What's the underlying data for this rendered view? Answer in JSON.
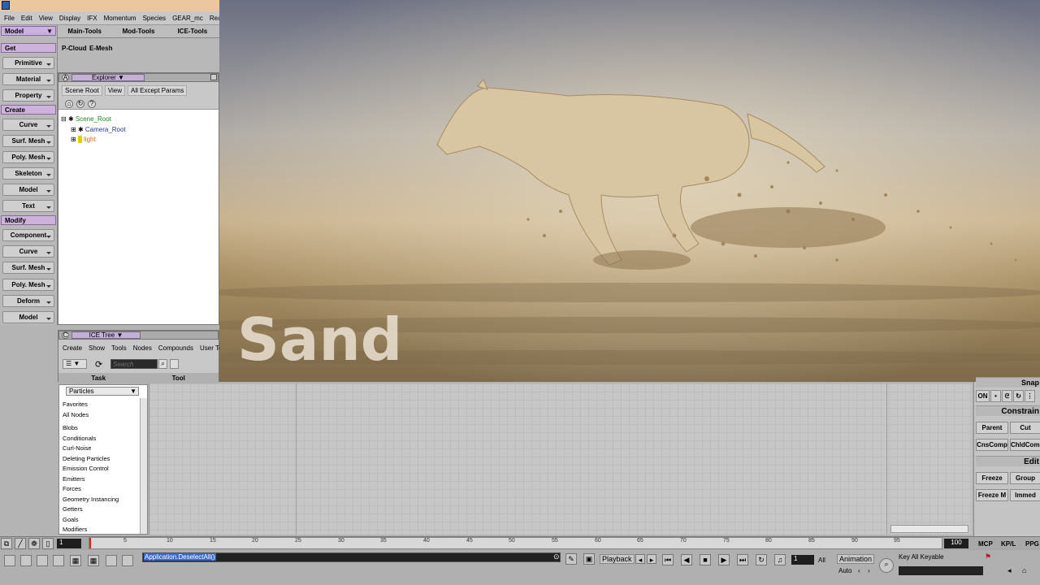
{
  "menus": [
    "File",
    "Edit",
    "View",
    "Display",
    "IFX",
    "Momentum",
    "Species",
    "GEAR_mc",
    "RealFlow"
  ],
  "left": {
    "mode": "Model",
    "sections": [
      {
        "name": "Get",
        "items": [
          "Primitive",
          "Material",
          "Property"
        ]
      },
      {
        "name": "Create",
        "items": [
          "Curve",
          "Surf. Mesh",
          "Poly. Mesh",
          "Skeleton",
          "Model",
          "Text"
        ]
      },
      {
        "name": "Modify",
        "items": [
          "Component",
          "Curve",
          "Surf. Mesh",
          "Poly. Mesh",
          "Deform",
          "Model"
        ]
      }
    ]
  },
  "tabs": [
    "Main-Tools",
    "Mod-Tools",
    "ICE-Tools"
  ],
  "ice_tools": [
    "P-Cloud",
    "E-Mesh"
  ],
  "explorer": {
    "title": "Explorer",
    "bar": [
      "Scene Root",
      "View",
      "All Except Params"
    ],
    "tree": [
      {
        "label": "Scene_Root",
        "color": "#1b8a1b"
      },
      {
        "label": "Camera_Root",
        "color": "#1a3aa0"
      },
      {
        "label": "light",
        "color": "#d86a10"
      }
    ]
  },
  "ice_tree": {
    "title": "ICE Tree",
    "menu": [
      "Create",
      "Show",
      "Tools",
      "Nodes",
      "Compounds",
      "User Tools"
    ],
    "search_placeholder": "Search",
    "task_tabs": [
      "Task",
      "Tool"
    ],
    "category": "Particles",
    "items": [
      "Favorites",
      "All Nodes",
      "Blobs",
      "Conditionals",
      "Curl-Noise",
      "Deleting Particles",
      "Emission Control",
      "Emitters",
      "Forces",
      "Geometry Instancing",
      "Getters",
      "Goals",
      "Modifiers"
    ]
  },
  "viewport": {
    "caption": "Sand"
  },
  "right": {
    "snap": "Snap",
    "on": "ON",
    "constrain": "Constrain",
    "constrain_btns": [
      "Parent",
      "Cut",
      "CnsComp",
      "ChldComp"
    ],
    "edit": "Edit",
    "edit_btns": [
      "Freeze",
      "Group",
      "Freeze M",
      "Immed"
    ]
  },
  "timeline": {
    "start": "1",
    "end": "100",
    "ticks": [
      "5",
      "10",
      "15",
      "20",
      "25",
      "30",
      "35",
      "40",
      "45",
      "50",
      "55",
      "60",
      "65",
      "70",
      "75",
      "80",
      "85",
      "90",
      "95"
    ],
    "modes": [
      "MCP",
      "KP/L",
      "PPG"
    ]
  },
  "command": "Application.DeselectAll()",
  "playback": {
    "label": "Playback",
    "frame": "1",
    "all": "All",
    "animation": "Animation",
    "auto": "Auto",
    "key_all": "Key All Keyable"
  }
}
